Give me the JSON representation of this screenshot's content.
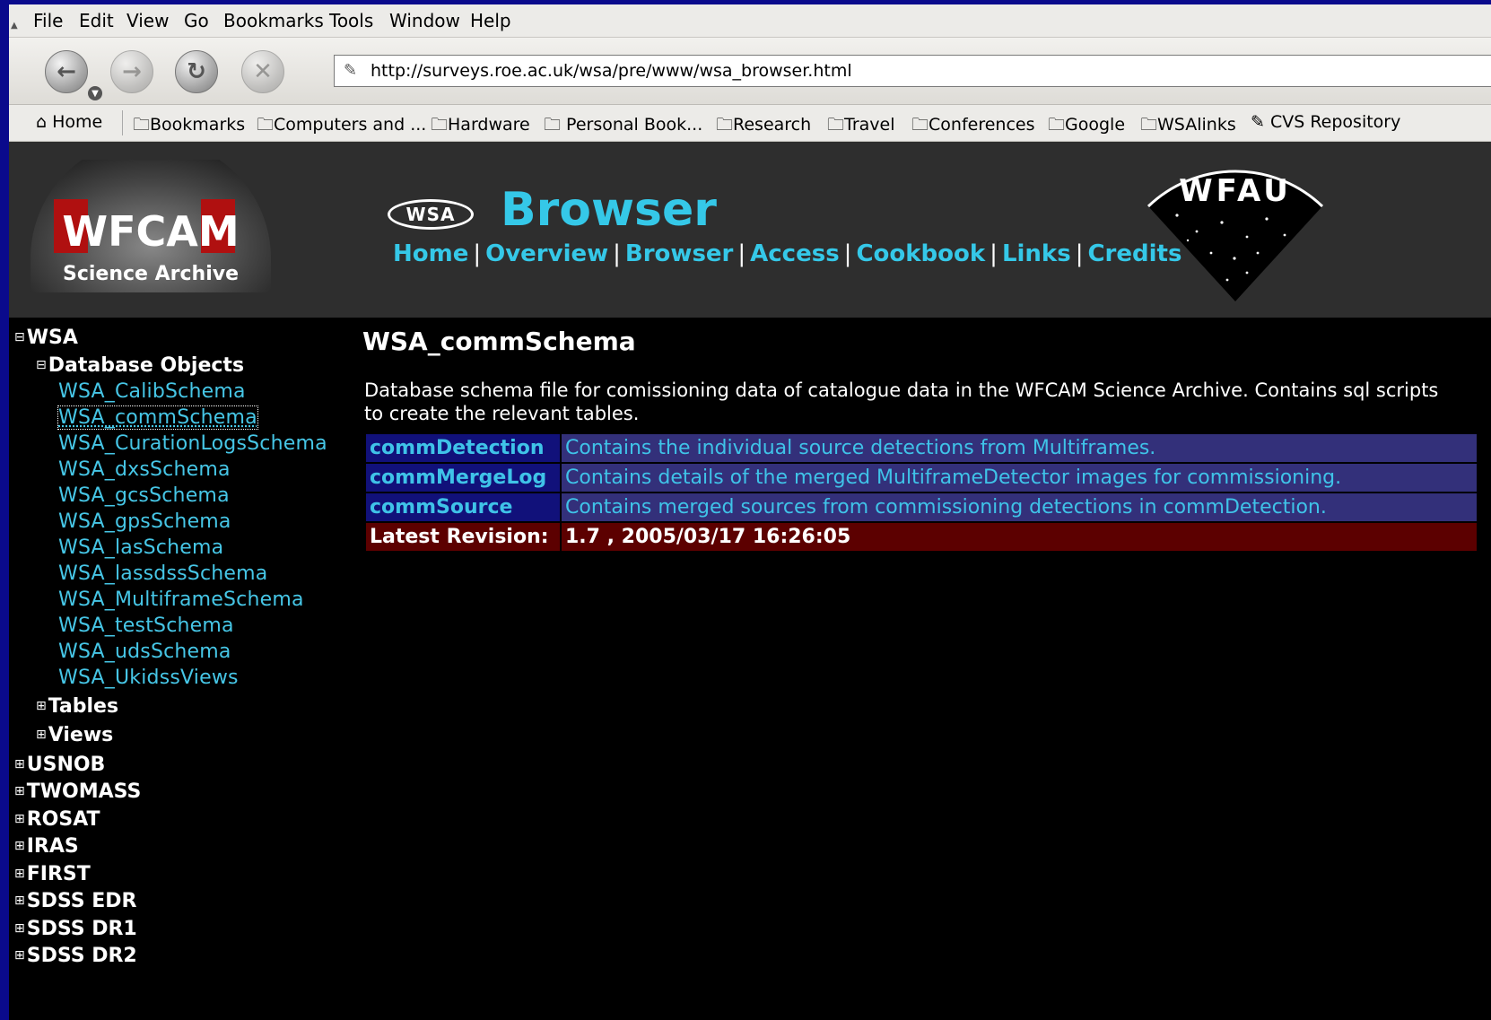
{
  "browser": {
    "menu": [
      "File",
      "Edit",
      "View",
      "Go",
      "Bookmarks",
      "Tools",
      "Window",
      "Help"
    ],
    "url": "http://surveys.roe.ac.uk/wsa/pre/www/wsa_browser.html",
    "bookmarks": [
      "Home",
      "Bookmarks",
      "Computers and ...",
      "Hardware",
      "Personal Book...",
      "Research",
      "Travel",
      "Conferences",
      "Google",
      "WSAlinks",
      "CVS Repository"
    ]
  },
  "header": {
    "logo_line1": "WFCAM",
    "logo_line2": "Science Archive",
    "badge": "WSA",
    "title": "Browser",
    "nav": [
      "Home",
      "Overview",
      "Browser",
      "Access",
      "Cookbook",
      "Links",
      "Credits"
    ],
    "wfau_text": "WFAU"
  },
  "tree": {
    "root": "WSA",
    "group": "Database Objects",
    "schemas": [
      "WSA_CalibSchema",
      "WSA_commSchema",
      "WSA_CurationLogsSchema",
      "WSA_dxsSchema",
      "WSA_gcsSchema",
      "WSA_gpsSchema",
      "WSA_lasSchema",
      "WSA_lassdssSchema",
      "WSA_MultiframeSchema",
      "WSA_testSchema",
      "WSA_udsSchema",
      "WSA_UkidssViews"
    ],
    "selected_schema": "WSA_commSchema",
    "subgroups": [
      "Tables",
      "Views"
    ],
    "databases": [
      "USNOB",
      "TWOMASS",
      "ROSAT",
      "IRAS",
      "FIRST",
      "SDSS EDR",
      "SDSS DR1",
      "SDSS DR2"
    ]
  },
  "main": {
    "title": "WSA_commSchema",
    "description": "Database schema file for comissioning data of catalogue data in the WFCAM Science Archive. Contains sql scripts to create the relevant tables.",
    "objects": [
      {
        "name": "commDetection",
        "desc": "Contains the individual source detections from Multiframes."
      },
      {
        "name": "commMergeLog",
        "desc": "Contains details of the merged MultiframeDetector images for commissioning."
      },
      {
        "name": "commSource",
        "desc": "Contains merged sources from commissioning detections in commDetection."
      }
    ],
    "revision_label": "Latest Revision:",
    "revision_value": "1.7 , 2005/03/17 16:26:05"
  },
  "colors": {
    "accent_cyan": "#35c8e8",
    "table_name_bg": "#11117a",
    "table_desc_bg": "#33307a",
    "revision_bg": "#5c0000",
    "header_bg": "#2e2e2e"
  }
}
